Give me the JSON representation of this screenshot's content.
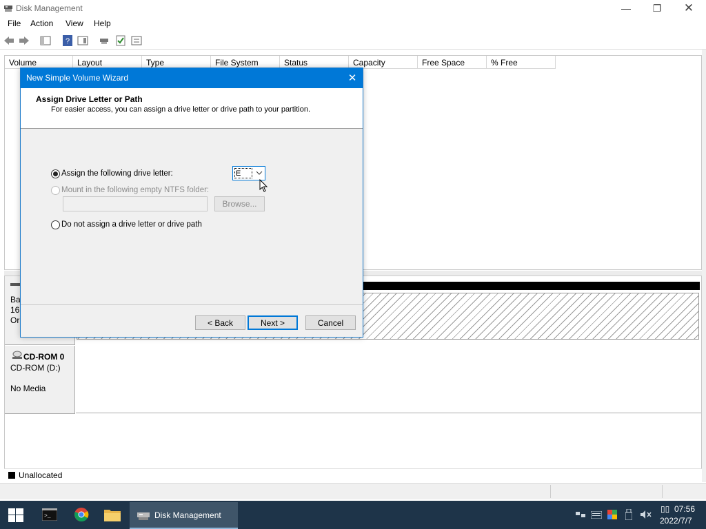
{
  "app": {
    "title": "Disk Management"
  },
  "menu": [
    "File",
    "Action",
    "View",
    "Help"
  ],
  "columns": [
    "Volume",
    "Layout",
    "Type",
    "File System",
    "Status",
    "Capacity",
    "Free Space",
    "% Free"
  ],
  "disks": {
    "disk0_partial": [
      "Ba",
      "16(",
      "Or"
    ],
    "cdrom": {
      "name": "CD-ROM 0",
      "type": "CD-ROM (D:)",
      "media": "No Media"
    }
  },
  "legend": {
    "unallocated": "Unallocated"
  },
  "dialog": {
    "title": "New Simple Volume Wizard",
    "heading": "Assign Drive Letter or Path",
    "subheading": "For easier access, you can assign a drive letter or drive path to your partition.",
    "option_assign": "Assign the following drive letter:",
    "drive_letter": "E",
    "option_mount": "Mount in the following empty NTFS folder:",
    "browse": "Browse...",
    "option_none": "Do not assign a drive letter or drive path",
    "back": "< Back",
    "next": "Next >",
    "cancel": "Cancel"
  },
  "taskbar": {
    "active_app": "Disk Management",
    "time": "07:56",
    "date": "2022/7/7",
    "ime": "▯▯"
  },
  "colors": {
    "accent": "#0078d7",
    "taskbar": "#1e3449"
  }
}
